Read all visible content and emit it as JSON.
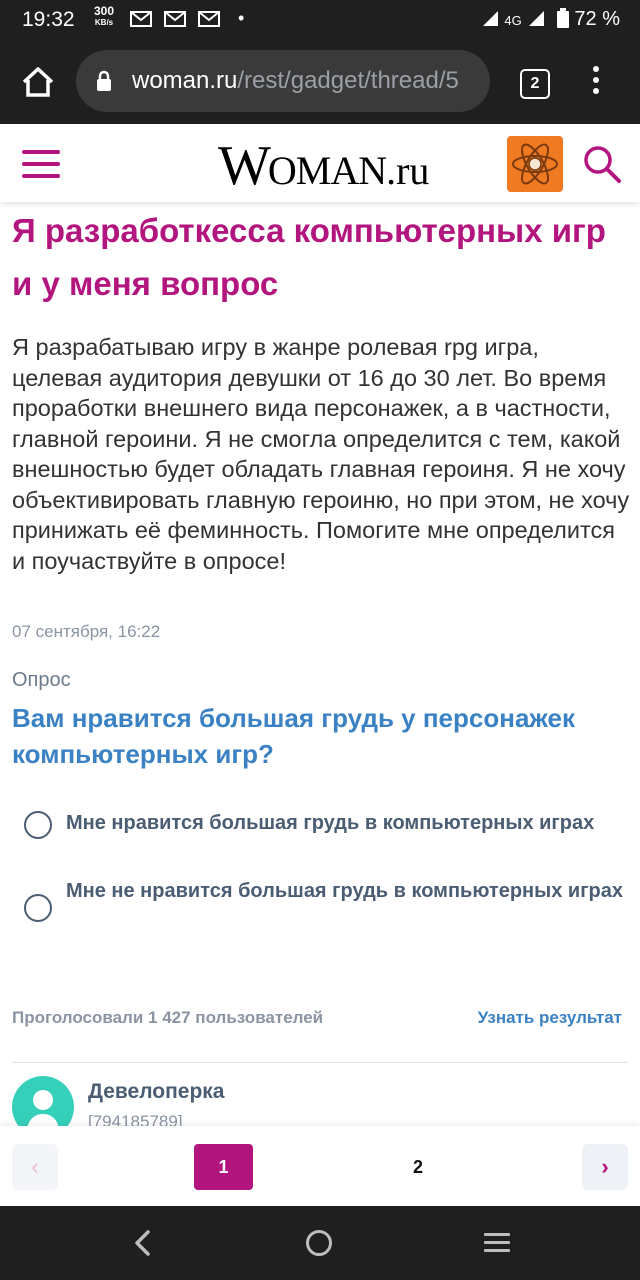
{
  "status_bar": {
    "time": "19:32",
    "speed_value": "300",
    "speed_unit": "KB/s",
    "network": "4G",
    "battery": "72 %"
  },
  "browser": {
    "url_domain": "woman.ru",
    "url_path": "/rest/gadget/thread/5",
    "tab_count": "2"
  },
  "site": {
    "logo_w": "W",
    "logo_oman": "OMAN",
    "logo_ru": ".ru",
    "accent_color": "#b3157f"
  },
  "post": {
    "title": "Я разработкесса компьютерных игр и у меня вопрос",
    "body": "Я разрабатываю игру в жанре ролевая rpg игра, целевая аудитория девушки от 16 до 30 лет. Во время проработки внешнего вида персонажек, а в частности, главной героини. Я не смогла определится с тем, какой внешностью будет обладать главная героиня. Я не хочу объективировать главную героиню, но при этом, не хочу принижать её феминность. Помогите мне определится и поучаствуйте в опросе!",
    "date": "07 сентября, 16:22"
  },
  "poll": {
    "label": "Опрос",
    "question": "Вам нравится большая грудь у персонажек компьютерных игр?",
    "options": [
      {
        "label": "Мне нравится большая грудь в компьютерных играх"
      },
      {
        "label": "Мне не нравится большая грудь в компьютерных играх"
      }
    ],
    "votes_text": "Проголосовали 1 427 пользователей",
    "result_link": "Узнать результат"
  },
  "author": {
    "name": "Девелоперка",
    "id": "[794185789]"
  },
  "pagination": {
    "prev": "‹",
    "pages": [
      "1",
      "2"
    ],
    "next": "›"
  }
}
